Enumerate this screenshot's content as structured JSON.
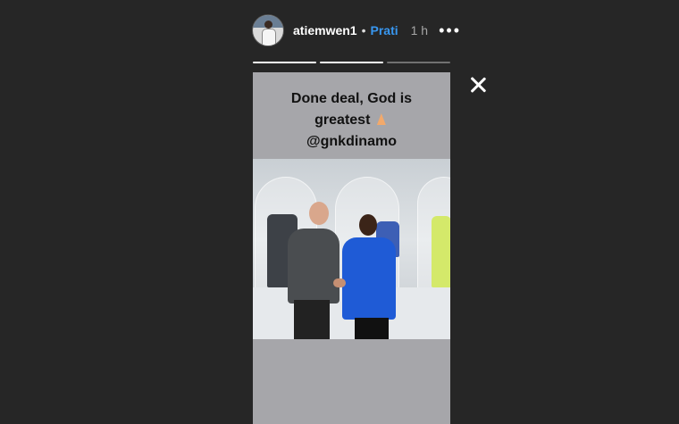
{
  "header": {
    "username": "atiemwen1",
    "separator": "•",
    "follow_label": "Prati",
    "time": "1 h",
    "more": "•••"
  },
  "story": {
    "progress_segments": [
      {
        "done": true
      },
      {
        "done": true
      },
      {
        "done": false
      }
    ],
    "caption_line1": "Done deal, God is",
    "caption_line2": "greatest",
    "caption_emoji": "praying-hands",
    "caption_line3": "@gnkdinamo"
  },
  "icons": {
    "close": "close-icon",
    "more": "more-options-icon"
  },
  "colors": {
    "background": "#262626",
    "follow": "#3897f0",
    "time": "#a6a6a6",
    "story_bg": "#a6a6aa"
  }
}
